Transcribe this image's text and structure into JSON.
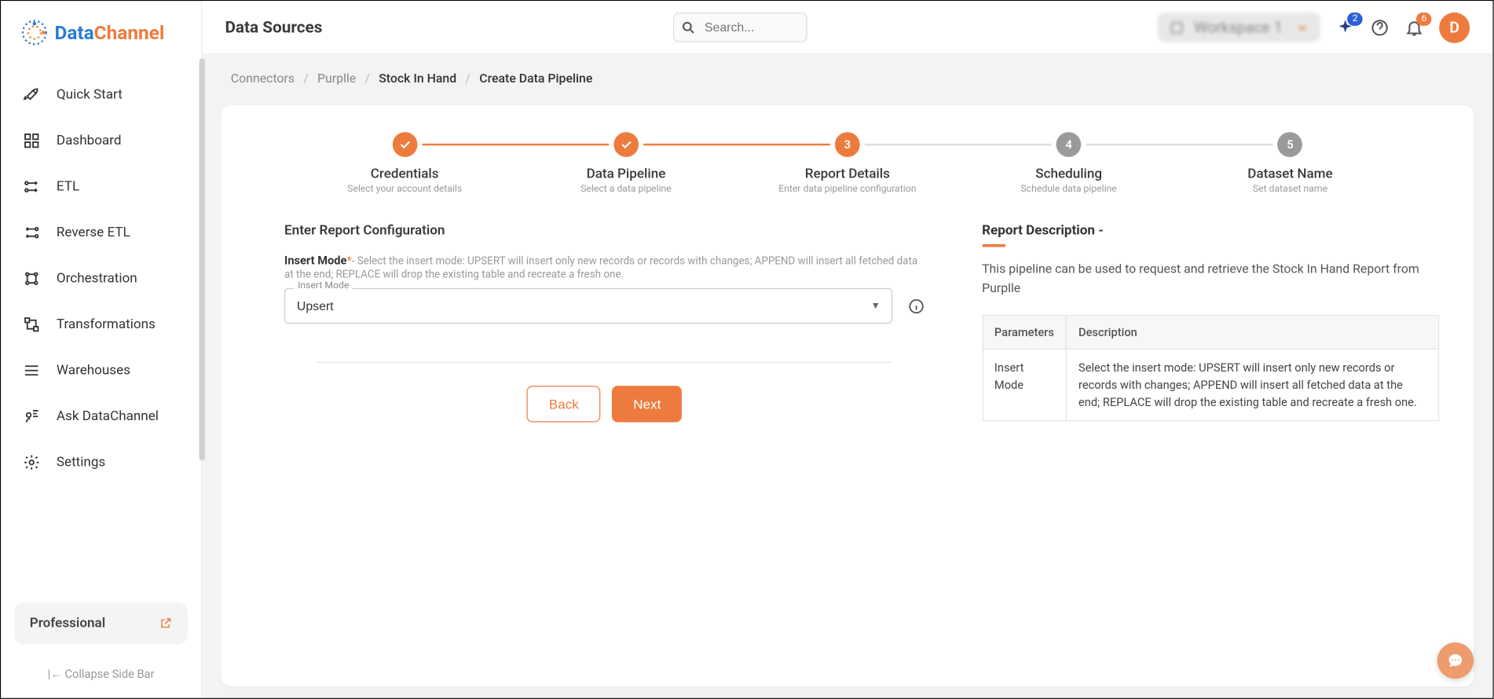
{
  "brand": {
    "part1": "Data",
    "part2": "Channel"
  },
  "sidebar": {
    "items": [
      {
        "label": "Quick Start"
      },
      {
        "label": "Dashboard"
      },
      {
        "label": "ETL"
      },
      {
        "label": "Reverse ETL"
      },
      {
        "label": "Orchestration"
      },
      {
        "label": "Transformations"
      },
      {
        "label": "Warehouses"
      },
      {
        "label": "Ask DataChannel"
      },
      {
        "label": "Settings"
      }
    ],
    "plan": "Professional",
    "collapse": "Collapse Side Bar"
  },
  "header": {
    "title": "Data Sources",
    "search_placeholder": "Search...",
    "workspace": "Workspace 1",
    "sparkle_badge": "2",
    "bell_badge": "6",
    "avatar_initial": "D"
  },
  "breadcrumbs": {
    "items": [
      "Connectors",
      "Purplle",
      "Stock In Hand",
      "Create Data Pipeline"
    ]
  },
  "stepper": [
    {
      "label": "Credentials",
      "sub": "Select your account details",
      "state": "done"
    },
    {
      "label": "Data Pipeline",
      "sub": "Select a data pipeline",
      "state": "done"
    },
    {
      "label": "Report Details",
      "sub": "Enter data pipeline configuration",
      "state": "active",
      "num": "3"
    },
    {
      "label": "Scheduling",
      "sub": "Schedule data pipeline",
      "state": "pending",
      "num": "4"
    },
    {
      "label": "Dataset Name",
      "sub": "Set dataset name",
      "state": "pending",
      "num": "5"
    }
  ],
  "form": {
    "section_title": "Enter Report Configuration",
    "field_name": "Insert Mode",
    "field_required": "*",
    "field_hint": "- Select the insert mode: UPSERT will insert only new records or records with changes; APPEND will insert all fetched data at the end; REPLACE will drop the existing table and recreate a fresh one.",
    "floating_label": "Insert Mode",
    "selected_value": "Upsert",
    "back_label": "Back",
    "next_label": "Next"
  },
  "desc": {
    "title": "Report Description -",
    "text": "This pipeline can be used to request and retrieve the Stock In Hand Report from Purplle",
    "table": {
      "h1": "Parameters",
      "h2": "Description",
      "r1c1": "Insert Mode",
      "r1c2": "Select the insert mode: UPSERT will insert only new records or records with changes; APPEND will insert all fetched data at the end; REPLACE will drop the existing table and recreate a fresh one."
    }
  }
}
